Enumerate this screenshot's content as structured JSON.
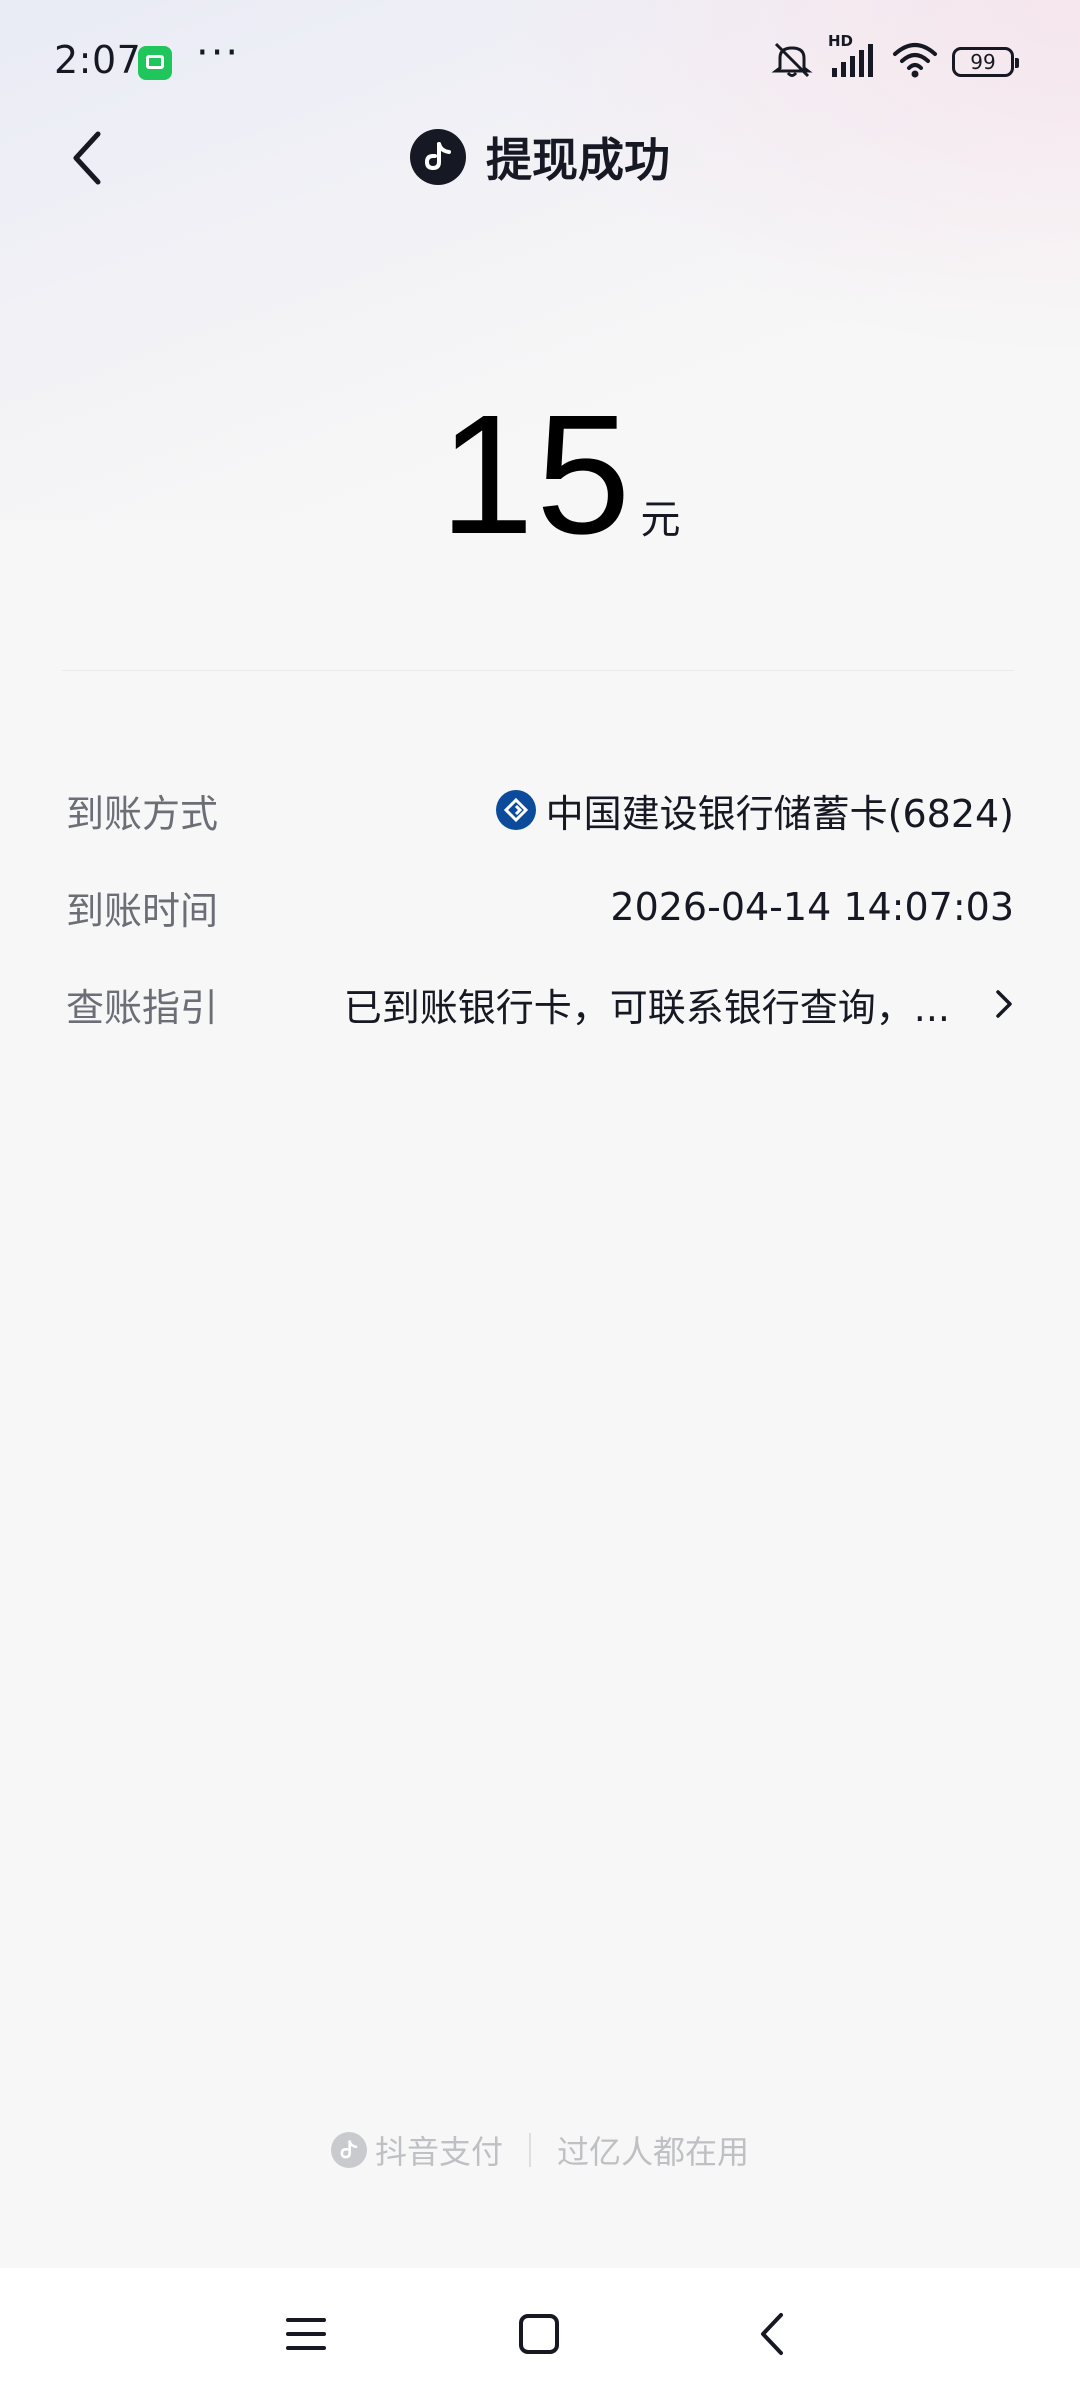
{
  "status_bar": {
    "time": "2:07",
    "more": "···",
    "battery": "99",
    "network": "HD"
  },
  "header": {
    "title": "提现成功"
  },
  "amount": {
    "value": "15",
    "unit": "元"
  },
  "details": [
    {
      "label": "到账方式",
      "value": "中国建设银行储蓄卡(6824)"
    },
    {
      "label": "到账时间",
      "value": "2026-04-14 14:07:03"
    },
    {
      "label": "查账指引",
      "value": "已到账银行卡，可联系银行查询，..."
    }
  ],
  "footer": {
    "brand": "抖音支付",
    "slogan": "过亿人都在用"
  },
  "colors": {
    "text_primary": "#161823",
    "text_secondary": "#6b6e76",
    "bank_blue": "#0c4b9c",
    "footer_gray": "#bfc0c4"
  }
}
